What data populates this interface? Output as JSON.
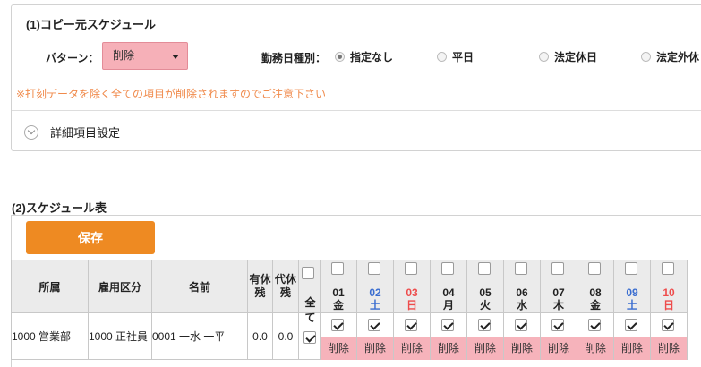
{
  "section1": {
    "title": "(1)コピー元スケジュール",
    "pattern_label": "パターン：",
    "pattern_value": "削除",
    "daytype_label": "勤務日種別：",
    "daytype_options": [
      "指定なし",
      "平日",
      "法定休日",
      "法定外休"
    ],
    "daytype_selected": "指定なし",
    "warning": "※打刻データを除く全ての項目が削除されますのでご注意下さい",
    "detail_label": "詳細項目設定"
  },
  "section2": {
    "title": "(2)スケジュール表",
    "save_label": "保存"
  },
  "table": {
    "headers": {
      "dept": "所属",
      "employment": "雇用区分",
      "name": "名前",
      "paid_leave": [
        "有休",
        "残"
      ],
      "comp_leave": [
        "代休",
        "残"
      ],
      "all": "全て"
    },
    "days": [
      {
        "num": "01",
        "wd": "金"
      },
      {
        "num": "02",
        "wd": "土"
      },
      {
        "num": "03",
        "wd": "日"
      },
      {
        "num": "04",
        "wd": "月"
      },
      {
        "num": "05",
        "wd": "火"
      },
      {
        "num": "06",
        "wd": "水"
      },
      {
        "num": "07",
        "wd": "木"
      },
      {
        "num": "08",
        "wd": "金"
      },
      {
        "num": "09",
        "wd": "土"
      },
      {
        "num": "10",
        "wd": "日"
      }
    ],
    "rows": [
      {
        "dept": "1000 営業部",
        "employment": "1000 正社員",
        "name": "0001 一水 一平",
        "paid_leave": "0.0",
        "comp_leave": "0.0",
        "cell_label": "削除"
      }
    ]
  },
  "colors": {
    "accent_orange": "#ee8a22",
    "delete_pink": "#f6b3bb",
    "warning_text": "#f08a4b",
    "saturday": "#3a6dd0",
    "sunday": "#ee4c4c"
  }
}
